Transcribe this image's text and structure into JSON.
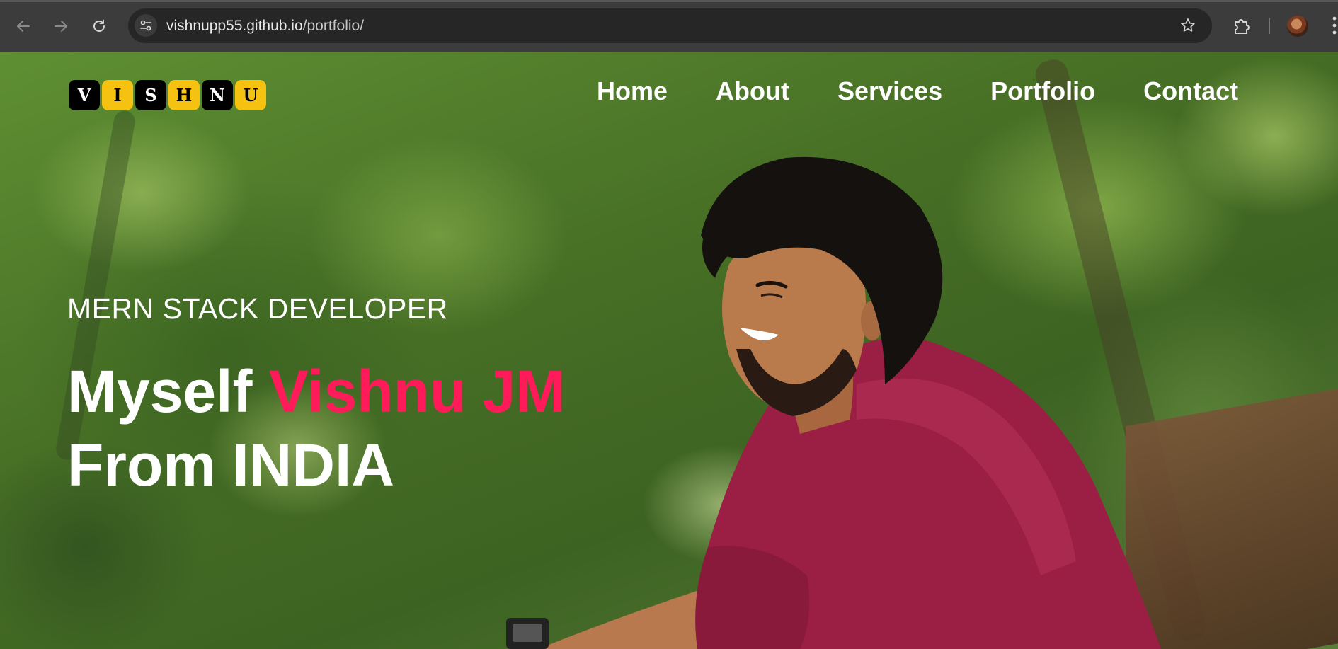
{
  "browser": {
    "url_host": "vishnupp55.github.io",
    "url_path": "/portfolio/"
  },
  "site": {
    "logo_letters": [
      "V",
      "I",
      "S",
      "H",
      "N",
      "U"
    ],
    "nav": [
      {
        "label": "Home"
      },
      {
        "label": "About"
      },
      {
        "label": "Services"
      },
      {
        "label": "Portfolio"
      },
      {
        "label": "Contact"
      }
    ]
  },
  "hero": {
    "subtitle": "MERN STACK DEVELOPER",
    "line1_prefix": "Myself ",
    "line1_name": "Vishnu JM",
    "line2": "From INDIA"
  },
  "colors": {
    "accent": "#ff1b59",
    "logo_yellow": "#f6c211",
    "logo_dark": "#000000"
  }
}
